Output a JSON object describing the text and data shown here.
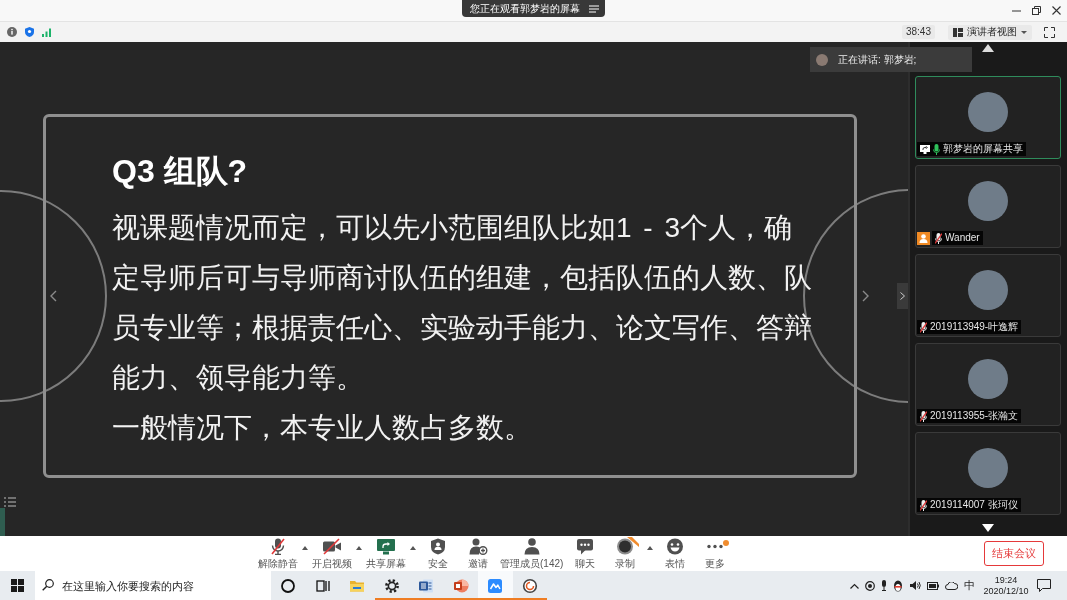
{
  "window": {
    "banner": "您正在观看郭梦岩的屏幕"
  },
  "meeting_bar": {
    "timer": "38:43",
    "view_button": "演讲者视图"
  },
  "slide": {
    "title": "Q3 组队?",
    "paragraphs": [
      "视课题情况而定，可以先小范围组队比如1 - 3个人，确定导师后可与导师商讨队伍的组建，包括队伍的人数、队员专业等；根据责任心、实验动手能力、论文写作、答辩能力、领导能力等。",
      "一般情况下，本专业人数占多数。"
    ]
  },
  "speaker": {
    "label": "正在讲话: 郭梦岩;"
  },
  "participants": [
    {
      "name": "郭梦岩的屏幕共享",
      "kind": "screen-share",
      "selected": true,
      "muted": false,
      "host": false
    },
    {
      "name": "Wander",
      "kind": "person",
      "selected": false,
      "muted": true,
      "host": true
    },
    {
      "name": "2019113949-叶逸辉",
      "kind": "person",
      "selected": false,
      "muted": true,
      "host": false
    },
    {
      "name": "2019113955-张瀚文",
      "kind": "person",
      "selected": false,
      "muted": true,
      "host": false
    },
    {
      "name": "2019114007 张珂仪",
      "kind": "person",
      "selected": false,
      "muted": true,
      "host": false
    }
  ],
  "toolbar": {
    "buttons": [
      {
        "label": "解除静音",
        "kind": "mic",
        "menu": true,
        "new_tag": false,
        "notification": false
      },
      {
        "label": "开启视频",
        "kind": "video",
        "menu": true,
        "new_tag": false,
        "notification": false
      },
      {
        "label": "共享屏幕",
        "kind": "share",
        "menu": true,
        "new_tag": false,
        "notification": false
      },
      {
        "label": "安全",
        "kind": "security",
        "menu": false,
        "new_tag": false,
        "notification": false
      },
      {
        "label": "邀请",
        "kind": "invite",
        "menu": false,
        "new_tag": false,
        "notification": false
      },
      {
        "label": "管理成员(142)",
        "kind": "participants",
        "menu": false,
        "new_tag": false,
        "notification": false
      },
      {
        "label": "聊天",
        "kind": "chat",
        "menu": false,
        "new_tag": false,
        "notification": false
      },
      {
        "label": "录制",
        "kind": "record",
        "menu": true,
        "new_tag": true,
        "notification": false
      },
      {
        "label": "表情",
        "kind": "reactions",
        "menu": false,
        "new_tag": false,
        "notification": false
      },
      {
        "label": "更多",
        "kind": "more",
        "menu": false,
        "new_tag": false,
        "notification": true
      }
    ],
    "end_button": "结束会议"
  },
  "taskbar": {
    "search": {
      "placeholder": "在这里输入你要搜索的内容"
    },
    "apps": [
      {
        "kind": "search-circle",
        "running": false,
        "selected": false
      },
      {
        "kind": "task-view",
        "running": false,
        "selected": false
      },
      {
        "kind": "folder",
        "running": false,
        "selected": false
      },
      {
        "kind": "settings",
        "running": true,
        "selected": false
      },
      {
        "kind": "document",
        "running": true,
        "selected": false
      },
      {
        "kind": "presentation",
        "running": true,
        "selected": false
      },
      {
        "kind": "meeting",
        "running": true,
        "selected": true
      },
      {
        "kind": "ring",
        "running": true,
        "selected": false
      }
    ],
    "tray": {
      "ime": "中",
      "time": "19:24",
      "date": "2020/12/10"
    }
  }
}
